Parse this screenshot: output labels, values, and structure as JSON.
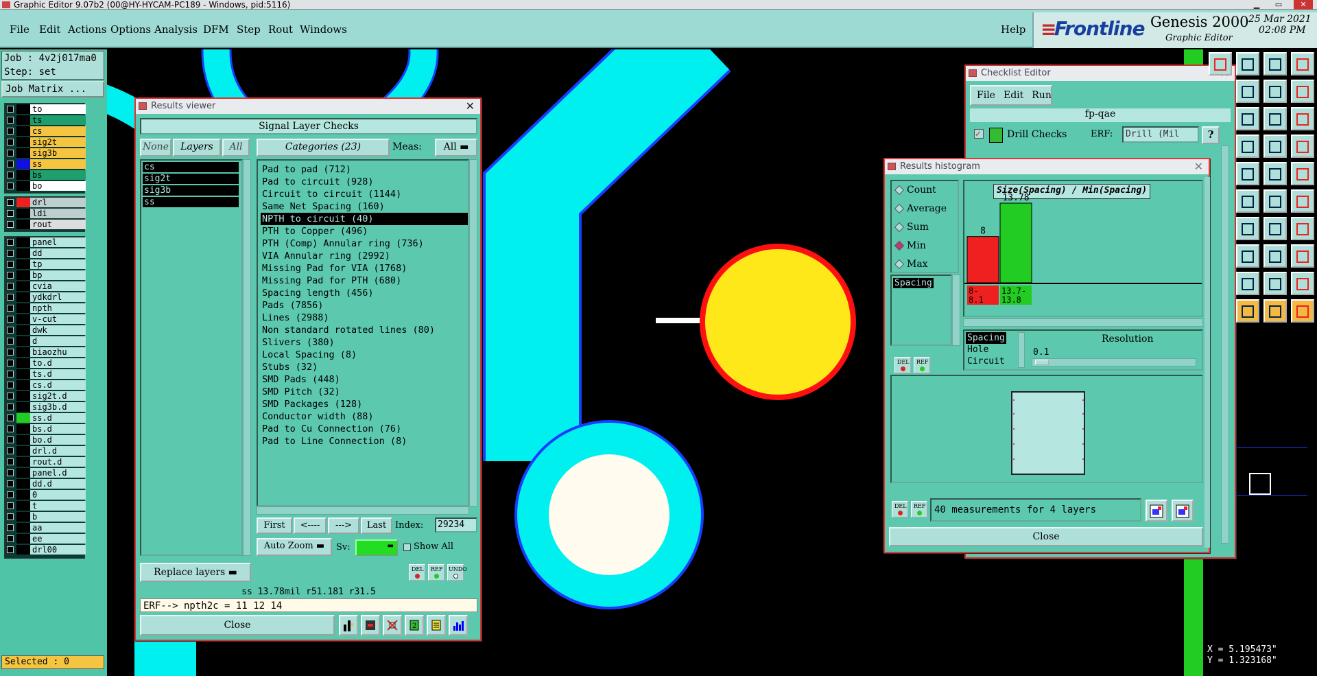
{
  "window_title": "Graphic Editor 9.07b2 (00@HY-HYCAM-PC189 - Windows, pid:5116)",
  "menu": {
    "items": [
      "File",
      "Edit",
      "Actions",
      "Options",
      "Analysis",
      "DFM",
      "Step",
      "Rout",
      "Windows"
    ],
    "help": "Help"
  },
  "brand": {
    "logo": "Frontline",
    "product": "Genesis 2000",
    "subtitle": "Graphic Editor",
    "date": "25 Mar 2021",
    "time": "02:08 PM"
  },
  "job": {
    "job_label": "Job : 4v2j017ma0",
    "step_label": "Step: set",
    "matrix_button": "Job Matrix ..."
  },
  "layers_group1": [
    {
      "name": "to",
      "color": "#000000",
      "bg": "#ffffff"
    },
    {
      "name": "ts",
      "color": "#000000",
      "bg": "#1f9e6e"
    },
    {
      "name": "cs",
      "color": "#000000",
      "bg": "#f5c542"
    },
    {
      "name": "sig2t",
      "color": "#000000",
      "bg": "#f5c542"
    },
    {
      "name": "sig3b",
      "color": "#000000",
      "bg": "#f5c542"
    },
    {
      "name": "ss",
      "color": "#1010e0",
      "bg": "#f5c542"
    },
    {
      "name": "bs",
      "color": "#000000",
      "bg": "#1f9e6e"
    },
    {
      "name": "bo",
      "color": "#000000",
      "bg": "#ffffff"
    }
  ],
  "layers_group2": [
    {
      "name": "drl",
      "color": "#ee2020",
      "bg": "#bfcfcf"
    },
    {
      "name": "ldi",
      "color": "#000000",
      "bg": "#bfcfcf"
    },
    {
      "name": "rout",
      "color": "#000000",
      "bg": "#dddddd"
    }
  ],
  "layers_group3": [
    {
      "name": "panel",
      "color": "#000000"
    },
    {
      "name": "dd",
      "color": "#000000"
    },
    {
      "name": "tp",
      "color": "#000000"
    },
    {
      "name": "bp",
      "color": "#000000"
    },
    {
      "name": "cvia",
      "color": "#000000"
    },
    {
      "name": "ydkdrl",
      "color": "#000000"
    },
    {
      "name": "npth",
      "color": "#000000"
    },
    {
      "name": "v-cut",
      "color": "#000000"
    },
    {
      "name": "dwk",
      "color": "#000000"
    },
    {
      "name": "d",
      "color": "#000000"
    },
    {
      "name": "biaozhu",
      "color": "#000000"
    },
    {
      "name": "to.d",
      "color": "#000000"
    },
    {
      "name": "ts.d",
      "color": "#000000"
    },
    {
      "name": "cs.d",
      "color": "#000000"
    },
    {
      "name": "sig2t.d",
      "color": "#000000"
    },
    {
      "name": "sig3b.d",
      "color": "#000000"
    },
    {
      "name": "ss.d",
      "color": "#22cc22"
    },
    {
      "name": "bs.d",
      "color": "#000000"
    },
    {
      "name": "bo.d",
      "color": "#000000"
    },
    {
      "name": "drl.d",
      "color": "#000000"
    },
    {
      "name": "rout.d",
      "color": "#000000"
    },
    {
      "name": "panel.d",
      "color": "#000000"
    },
    {
      "name": "dd.d",
      "color": "#000000"
    },
    {
      "name": "0",
      "color": "#000000"
    },
    {
      "name": "t",
      "color": "#000000"
    },
    {
      "name": "b",
      "color": "#000000"
    },
    {
      "name": "aa",
      "color": "#000000"
    },
    {
      "name": "ee",
      "color": "#000000"
    },
    {
      "name": "drl00",
      "color": "#000000"
    }
  ],
  "selected": "Selected : 0",
  "results_viewer": {
    "title": "Results viewer",
    "heading": "Signal Layer Checks",
    "btn_none": "None",
    "btn_layers": "Layers",
    "btn_all": "All",
    "categories_label": "Categories (23)",
    "meas_label": "Meas:",
    "meas_value": "All",
    "layers": [
      "cs",
      "sig2t",
      "sig3b",
      "ss"
    ],
    "categories": [
      "Pad to pad (712)",
      "Pad to circuit (928)",
      "Circuit to circuit (1144)",
      "Same Net Spacing (160)",
      "NPTH to circuit (40)",
      "PTH to Copper (496)",
      "PTH (Comp) Annular ring (736)",
      "VIA Annular ring (2992)",
      "Missing Pad for VIA (1768)",
      "Missing Pad for PTH (680)",
      "Spacing length (456)",
      "Pads (7856)",
      "Lines (2988)",
      "Non standard rotated lines (80)",
      "Slivers (380)",
      "Local Spacing (8)",
      "Stubs (32)",
      "SMD Pads (448)",
      "SMD Pitch (32)",
      "SMD Packages (128)",
      "Conductor width (88)",
      "Pad to Cu Connection (76)",
      "Pad to Line Connection (8)"
    ],
    "selected_category": "NPTH to circuit (40)",
    "nav": {
      "first": "First",
      "prev": "<----",
      "next": "--->",
      "last": "Last",
      "index_label": "Index:",
      "index_value": "29234"
    },
    "auto_zoom": "Auto Zoom",
    "sv_label": "Sv:",
    "show_all": "Show All",
    "replace_layers": "Replace layers",
    "status": "ss 13.78mil   r51.181   r31.5",
    "erf": "ERF--> npth2c = 11 12 14",
    "close": "Close"
  },
  "checklist_editor": {
    "title": "Checklist Editor",
    "menu": [
      "File",
      "Edit",
      "Run"
    ],
    "name": "fp-qae",
    "check_name": "Drill Checks",
    "erf_label": "ERF:",
    "erf_value": "Drill (Mil"
  },
  "histogram": {
    "title": "Results histogram",
    "options": [
      "Count",
      "Average",
      "Sum",
      "Min",
      "Max"
    ],
    "selected_option": "Min",
    "list_selected": "Spacing",
    "chart_title": "Size(Spacing) / Min(Spacing)",
    "bins": [
      {
        "label": "8-\n8.1",
        "range": "8-8.1",
        "value": 8,
        "color": "#ee2020"
      },
      {
        "label": "13.7-\n13.8",
        "range": "13.7-13.8",
        "value": 13.78,
        "color": "#22cc22"
      }
    ],
    "bin_value_labels": [
      "8",
      "13.78"
    ],
    "res_types": [
      "Spacing",
      "Hole",
      "Circuit"
    ],
    "res_selected": "Spacing",
    "resolution_label": "Resolution",
    "resolution_value": "0.1",
    "summary": "40 measurements for 4 layers",
    "close": "Close"
  },
  "coords": {
    "x": "X = 5.195473\"",
    "y": "Y = 1.323168\""
  },
  "colors": {
    "panel": "#5cc8ad",
    "light": "#aedfd9",
    "accent_red": "#ee2020",
    "pad_yellow": "#ffe81a",
    "trace_cyan": "#00f0f0"
  }
}
